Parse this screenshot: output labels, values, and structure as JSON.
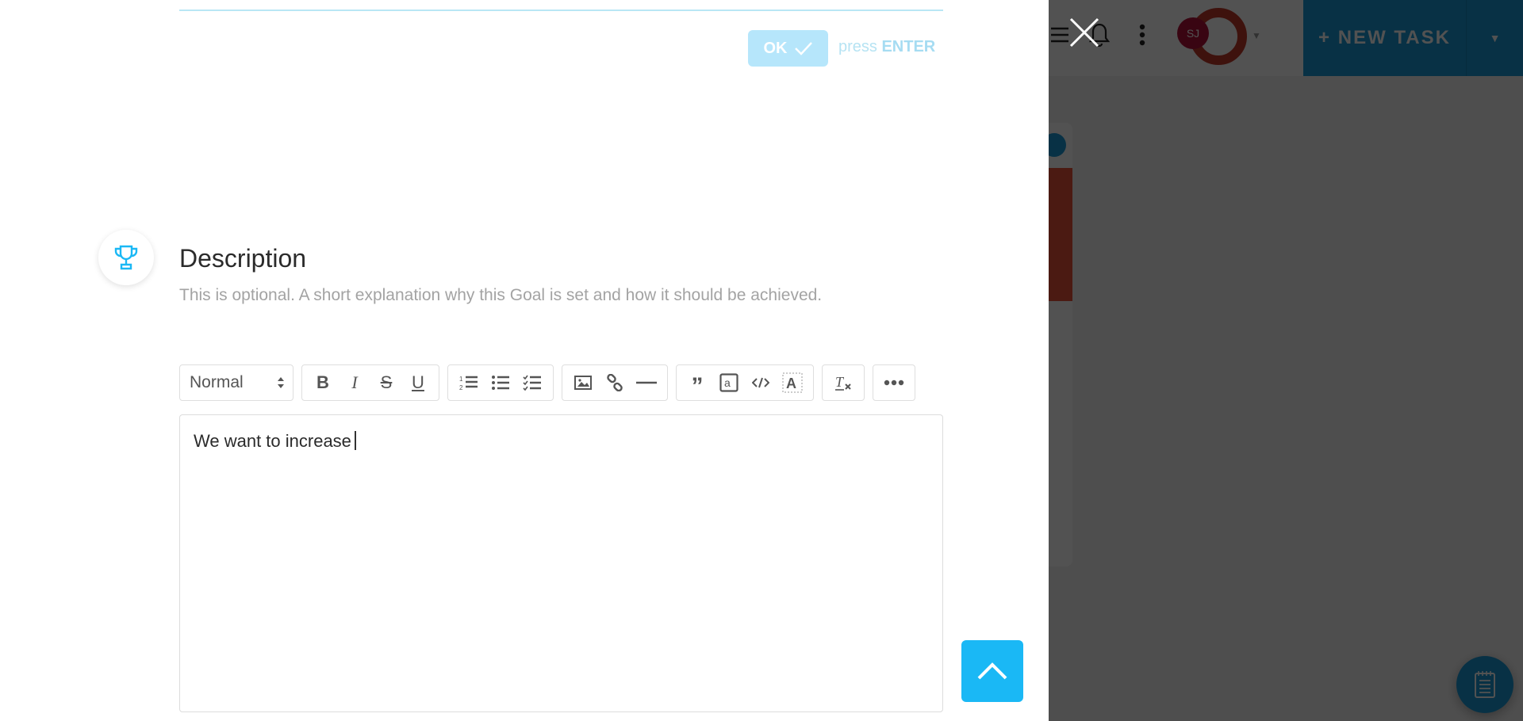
{
  "colors": {
    "accent": "#1ab8f5",
    "accent_soft": "#b6e6fb",
    "brand_blue": "#1a9ad6",
    "avatar_bg": "#b0103a",
    "help_text": "#a3a3a3"
  },
  "header": {
    "new_task_label": "+ NEW TASK",
    "avatar_initials": "SJ",
    "icons": [
      "menu-icon",
      "close-icon",
      "bell-icon",
      "kebab-icon",
      "chevron-down-icon"
    ]
  },
  "confirm": {
    "ok_label": "OK",
    "press_label": "press",
    "key_label": "ENTER"
  },
  "description": {
    "title": "Description",
    "help": "This is optional. A short explanation why this Goal is set and how it should be achieved.",
    "icon": "trophy-icon"
  },
  "toolbar": {
    "format_select": "Normal",
    "groups": [
      [
        "bold",
        "italic",
        "strikethrough",
        "underline"
      ],
      [
        "ordered-list",
        "bullet-list",
        "check-list"
      ],
      [
        "image",
        "link",
        "divider"
      ],
      [
        "blockquote",
        "inline-code-box",
        "code",
        "highlight"
      ],
      [
        "clear-format"
      ],
      [
        "more"
      ]
    ]
  },
  "editor": {
    "content": "We want to increase"
  },
  "fab_icon": "notepad-icon",
  "scroll_top_icon": "chevron-up-icon"
}
